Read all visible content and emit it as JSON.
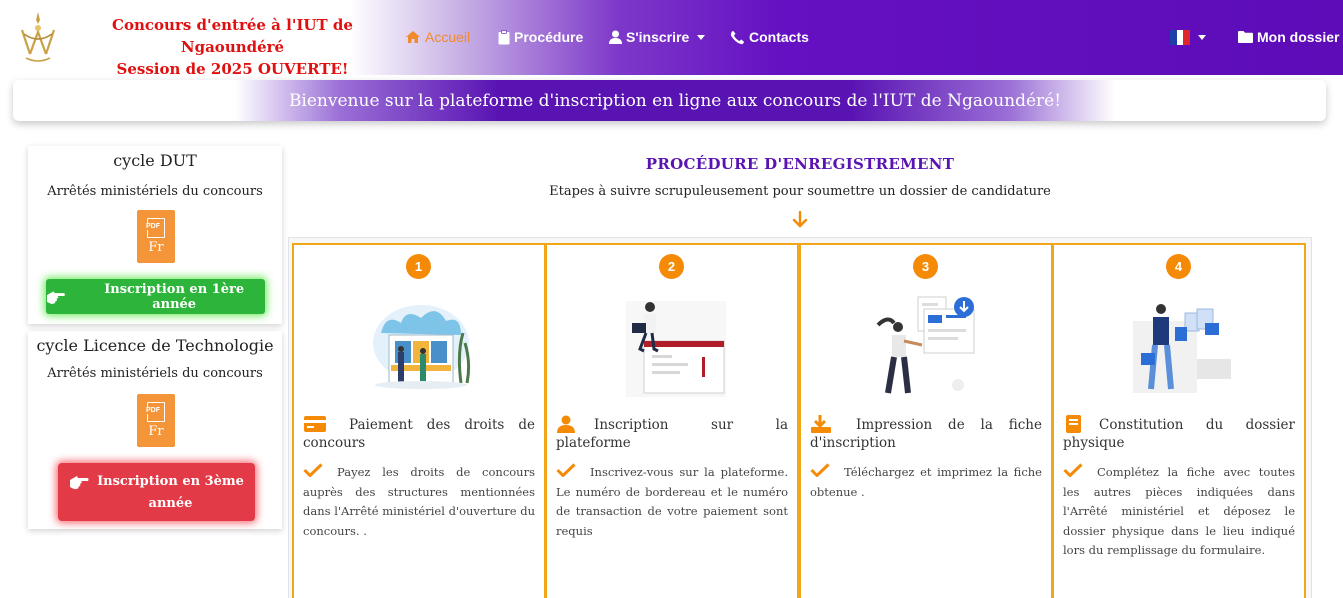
{
  "navbar": {
    "brand_line1": "Concours d'entrée à l'IUT de Ngaoundéré",
    "brand_line2": "Session de 2025 OUVERTE!",
    "items": [
      {
        "label": "Accueil",
        "icon": "home-icon",
        "active": true
      },
      {
        "label": "Procédure",
        "icon": "clipboard-icon"
      },
      {
        "label": "S'inscrire",
        "icon": "user-icon",
        "dropdown": true
      },
      {
        "label": "Contacts",
        "icon": "phone-icon"
      }
    ],
    "language_flag": "flag-fr-icon",
    "dossier_label": "Mon dossier",
    "colors": {
      "brand_text": "#e01010",
      "active": "#f08a2c",
      "purple": "#5d0cb8"
    }
  },
  "welcome": {
    "text": "Bienvenue sur la plateforme d'inscription en ligne aux concours de l'IUT de Ngaoundéré!"
  },
  "sidebar": {
    "cards": [
      {
        "title": "cycle DUT",
        "subtitle": "Arrêtés ministériels du concours",
        "pdf_badge": "PDF",
        "pdf_lang": "Fr",
        "button_label": "Inscription en 1ère année",
        "button_color": "#2cb53a"
      },
      {
        "title": "cycle Licence de Technologie",
        "subtitle": "Arrêtés ministériels du concours",
        "pdf_badge": "PDF",
        "pdf_lang": "Fr",
        "button_label_line1": "Inscription en 3ème",
        "button_label_line2": "année",
        "button_color": "#e23a46"
      }
    ]
  },
  "procedure": {
    "title": "PROCÉDURE D'ENREGISTREMENT",
    "subtitle": "Etapes à suivre scrupuleusement pour soumettre un dossier de candidature",
    "accent": "#f58a07",
    "steps": [
      {
        "number": "1",
        "icon": "credit-card-icon",
        "title": "Paiement des droits de concours",
        "text": "Payez les droits de concours auprès des structures mentionnées dans l'Arrêté ministériel d'ouverture du concours. ."
      },
      {
        "number": "2",
        "icon": "user-icon",
        "title": "Inscription sur la plateforme",
        "text": "Inscrivez-vous sur la plateforme. Le numéro de bordereau et le numéro de transaction de votre paiement sont requis"
      },
      {
        "number": "3",
        "icon": "download-icon",
        "title": "Impression de la fiche d'inscription",
        "text": "Téléchargez et imprimez la fiche obtenue ."
      },
      {
        "number": "4",
        "icon": "book-icon",
        "title": "Constitution du dossier physique",
        "text": "Complétez la fiche avec toutes les autres pièces indiquées dans l'Arrêté ministériel et déposez le dossier physique dans le lieu indiqué lors du remplissage du formulaire."
      }
    ]
  }
}
